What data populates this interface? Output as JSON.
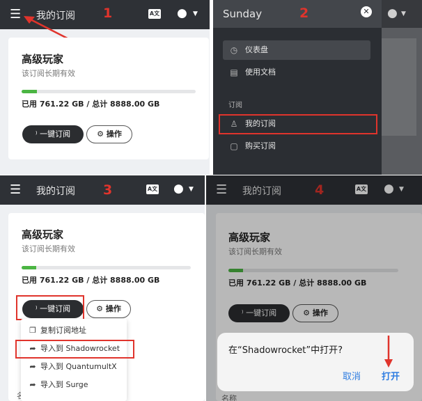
{
  "app_title": "我的订阅",
  "lang_icon_text": "A文",
  "plan": {
    "name": "高级玩家",
    "validity": "该订阅长期有效",
    "usage_text": "已用 761.22 GB / 总计 8888.00 GB",
    "usage_fraction": 0.086
  },
  "buttons": {
    "subscribe": "一键订阅",
    "operate": "操作"
  },
  "steps": [
    "1",
    "2",
    "3",
    "4"
  ],
  "drawer": {
    "title": "Sunday",
    "items": [
      {
        "label": "仪表盘",
        "icon": "dashboard-icon"
      },
      {
        "label": "使用文档",
        "icon": "book-icon"
      }
    ],
    "section": "订阅",
    "sub_items": [
      {
        "label": "我的订阅",
        "icon": "subscription-icon"
      },
      {
        "label": "购买订阅",
        "icon": "cart-icon"
      }
    ]
  },
  "dropdown": [
    {
      "label": "复制订阅地址",
      "icon": "copy-icon"
    },
    {
      "label": "导入到 Shadowrocket",
      "icon": "share-icon"
    },
    {
      "label": "导入到 QuantumultX",
      "icon": "share-icon"
    },
    {
      "label": "导入到 Surge",
      "icon": "share-icon"
    }
  ],
  "dialog": {
    "question": "在“Shadowrocket”中打开?",
    "cancel": "取消",
    "open": "打开"
  },
  "footer_label": "名称",
  "colors": {
    "topbar": "#2e3136",
    "accent_red": "#e0342c",
    "progress": "#4bb543",
    "link_blue": "#2f7de1"
  }
}
